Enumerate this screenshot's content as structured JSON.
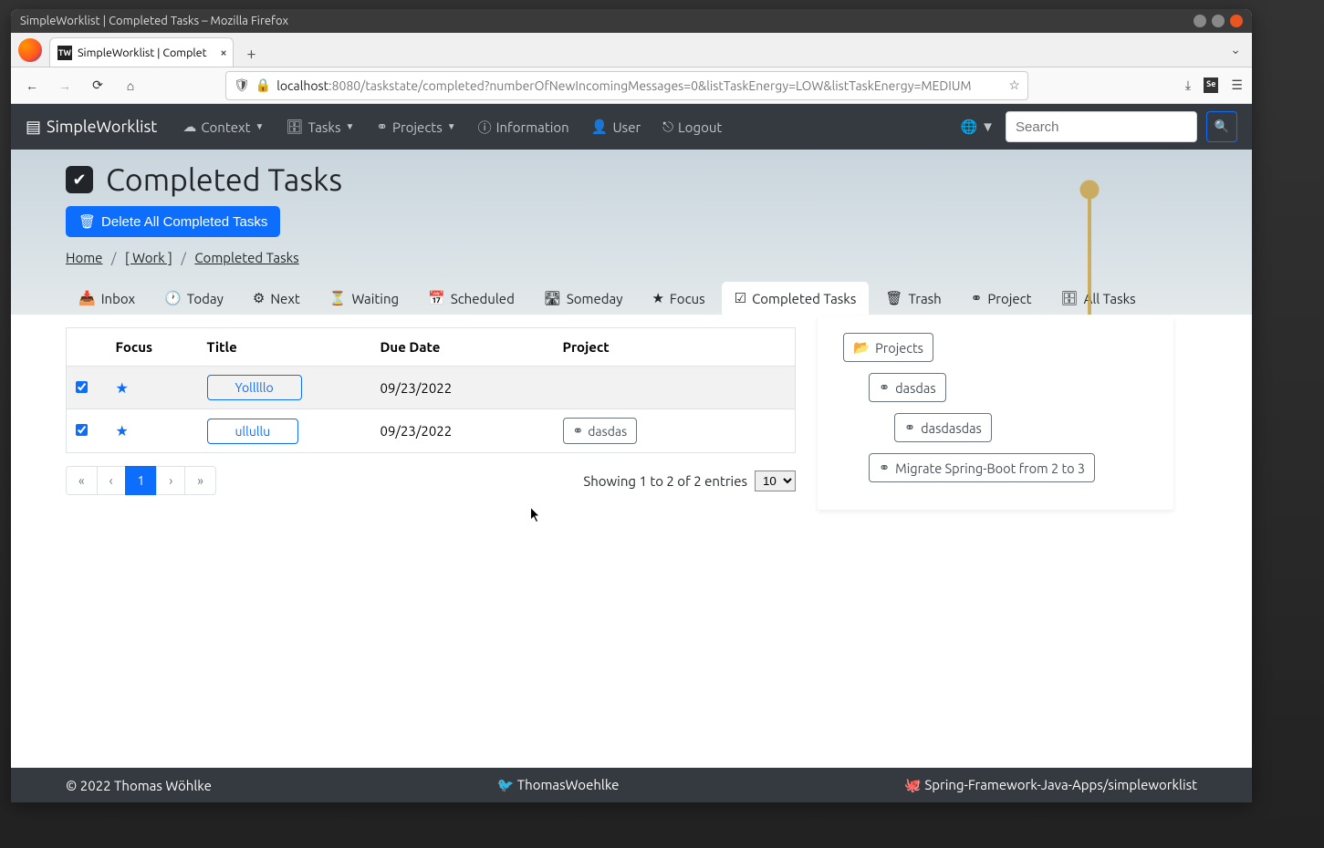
{
  "window": {
    "title": "SimpleWorklist | Completed Tasks – Mozilla Firefox"
  },
  "browser": {
    "tab_title": "SimpleWorklist | Complet",
    "favicon_text": "TW",
    "url_host": "localhost",
    "url_path": ":8080/taskstate/completed?numberOfNewIncomingMessages=0&listTaskEnergy=LOW&listTaskEnergy=MEDIUM"
  },
  "navbar": {
    "brand": "SimpleWorklist",
    "items": {
      "context": "Context",
      "tasks": "Tasks",
      "projects": "Projects",
      "information": "Information",
      "user": "User",
      "logout": "Logout"
    },
    "search_placeholder": "Search"
  },
  "page": {
    "title": "Completed Tasks",
    "delete_button": "Delete All Completed Tasks"
  },
  "breadcrumb": {
    "home": "Home",
    "work": "[ Work ]",
    "current": "Completed Tasks"
  },
  "tabs": {
    "inbox": "Inbox",
    "today": "Today",
    "next": "Next",
    "waiting": "Waiting",
    "scheduled": "Scheduled",
    "someday": "Someday",
    "focus": "Focus",
    "completed": "Completed Tasks",
    "trash": "Trash",
    "project": "Project",
    "all": "All Tasks"
  },
  "table": {
    "headers": {
      "focus": "Focus",
      "title": "Title",
      "due": "Due Date",
      "project": "Project"
    },
    "rows": [
      {
        "title": "Yolllllo",
        "due": "09/23/2022",
        "project": ""
      },
      {
        "title": "ullullu",
        "due": "09/23/2022",
        "project": "dasdas"
      }
    ]
  },
  "paging": {
    "first": "«",
    "prev": "‹",
    "page": "1",
    "next": "›",
    "last": "»",
    "showing": "Showing 1 to 2 of 2 entries",
    "page_size": "10"
  },
  "sidebar": {
    "root": "Projects",
    "items": [
      {
        "level": 2,
        "label": "dasdas"
      },
      {
        "level": 3,
        "label": "dasdasdas"
      },
      {
        "level": 2,
        "label": "Migrate Spring-Boot from 2 to 3"
      }
    ]
  },
  "footer": {
    "copyright": "© 2022 Thomas Wöhlke",
    "twitter": "ThomasWoehlke",
    "github": "Spring-Framework-Java-Apps/simpleworklist"
  }
}
